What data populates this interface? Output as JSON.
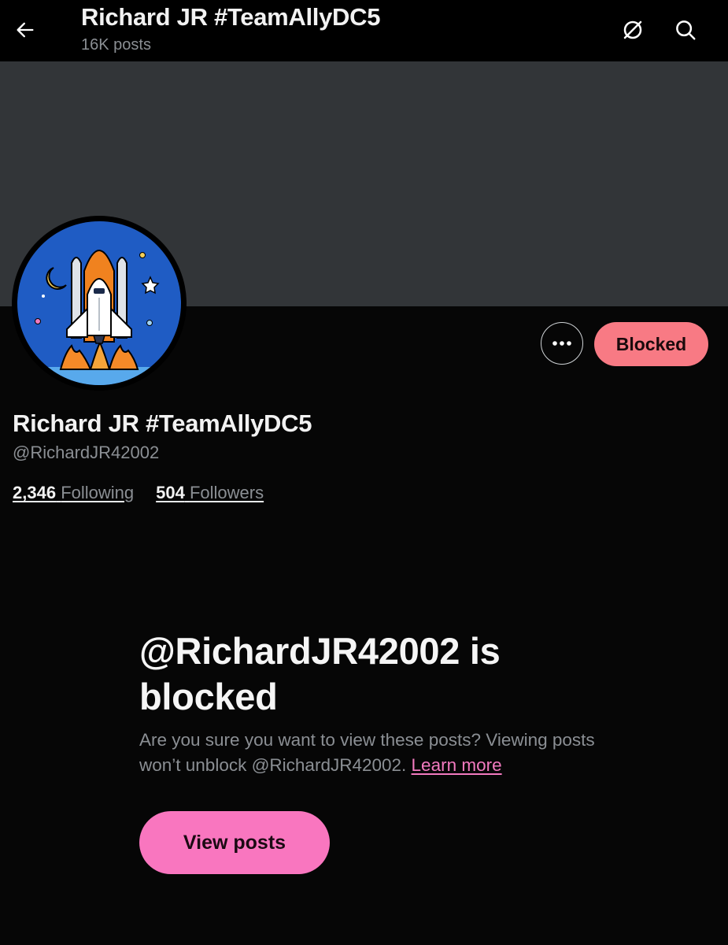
{
  "header": {
    "title": "Richard JR #TeamAllyDC5",
    "posts_count": "16K posts",
    "icons": [
      "back-arrow-icon",
      "grok-icon",
      "search-icon"
    ]
  },
  "profile": {
    "display_name": "Richard JR #TeamAllyDC5",
    "handle": "@RichardJR42002",
    "following_count": "2,346",
    "following_label": "Following",
    "followers_count": "504",
    "followers_label": "Followers",
    "avatar": "space-shuttle-launch-illustration"
  },
  "actions": {
    "blocked_label": "Blocked",
    "more_icon": "more-horizontal-icon"
  },
  "blocked_notice": {
    "title": "@RichardJR42002 is blocked",
    "description": "Are you sure you want to view these posts? Viewing posts won’t unblock @RichardJR42002.",
    "learn_more": "Learn more",
    "view_posts_label": "View posts"
  },
  "colors": {
    "background": "#060606",
    "banner": "#323538",
    "blocked_button": "#f87a84",
    "accent_pink": "#f976bf",
    "link": "#f37ac0",
    "secondary_text": "#8b8f94"
  }
}
